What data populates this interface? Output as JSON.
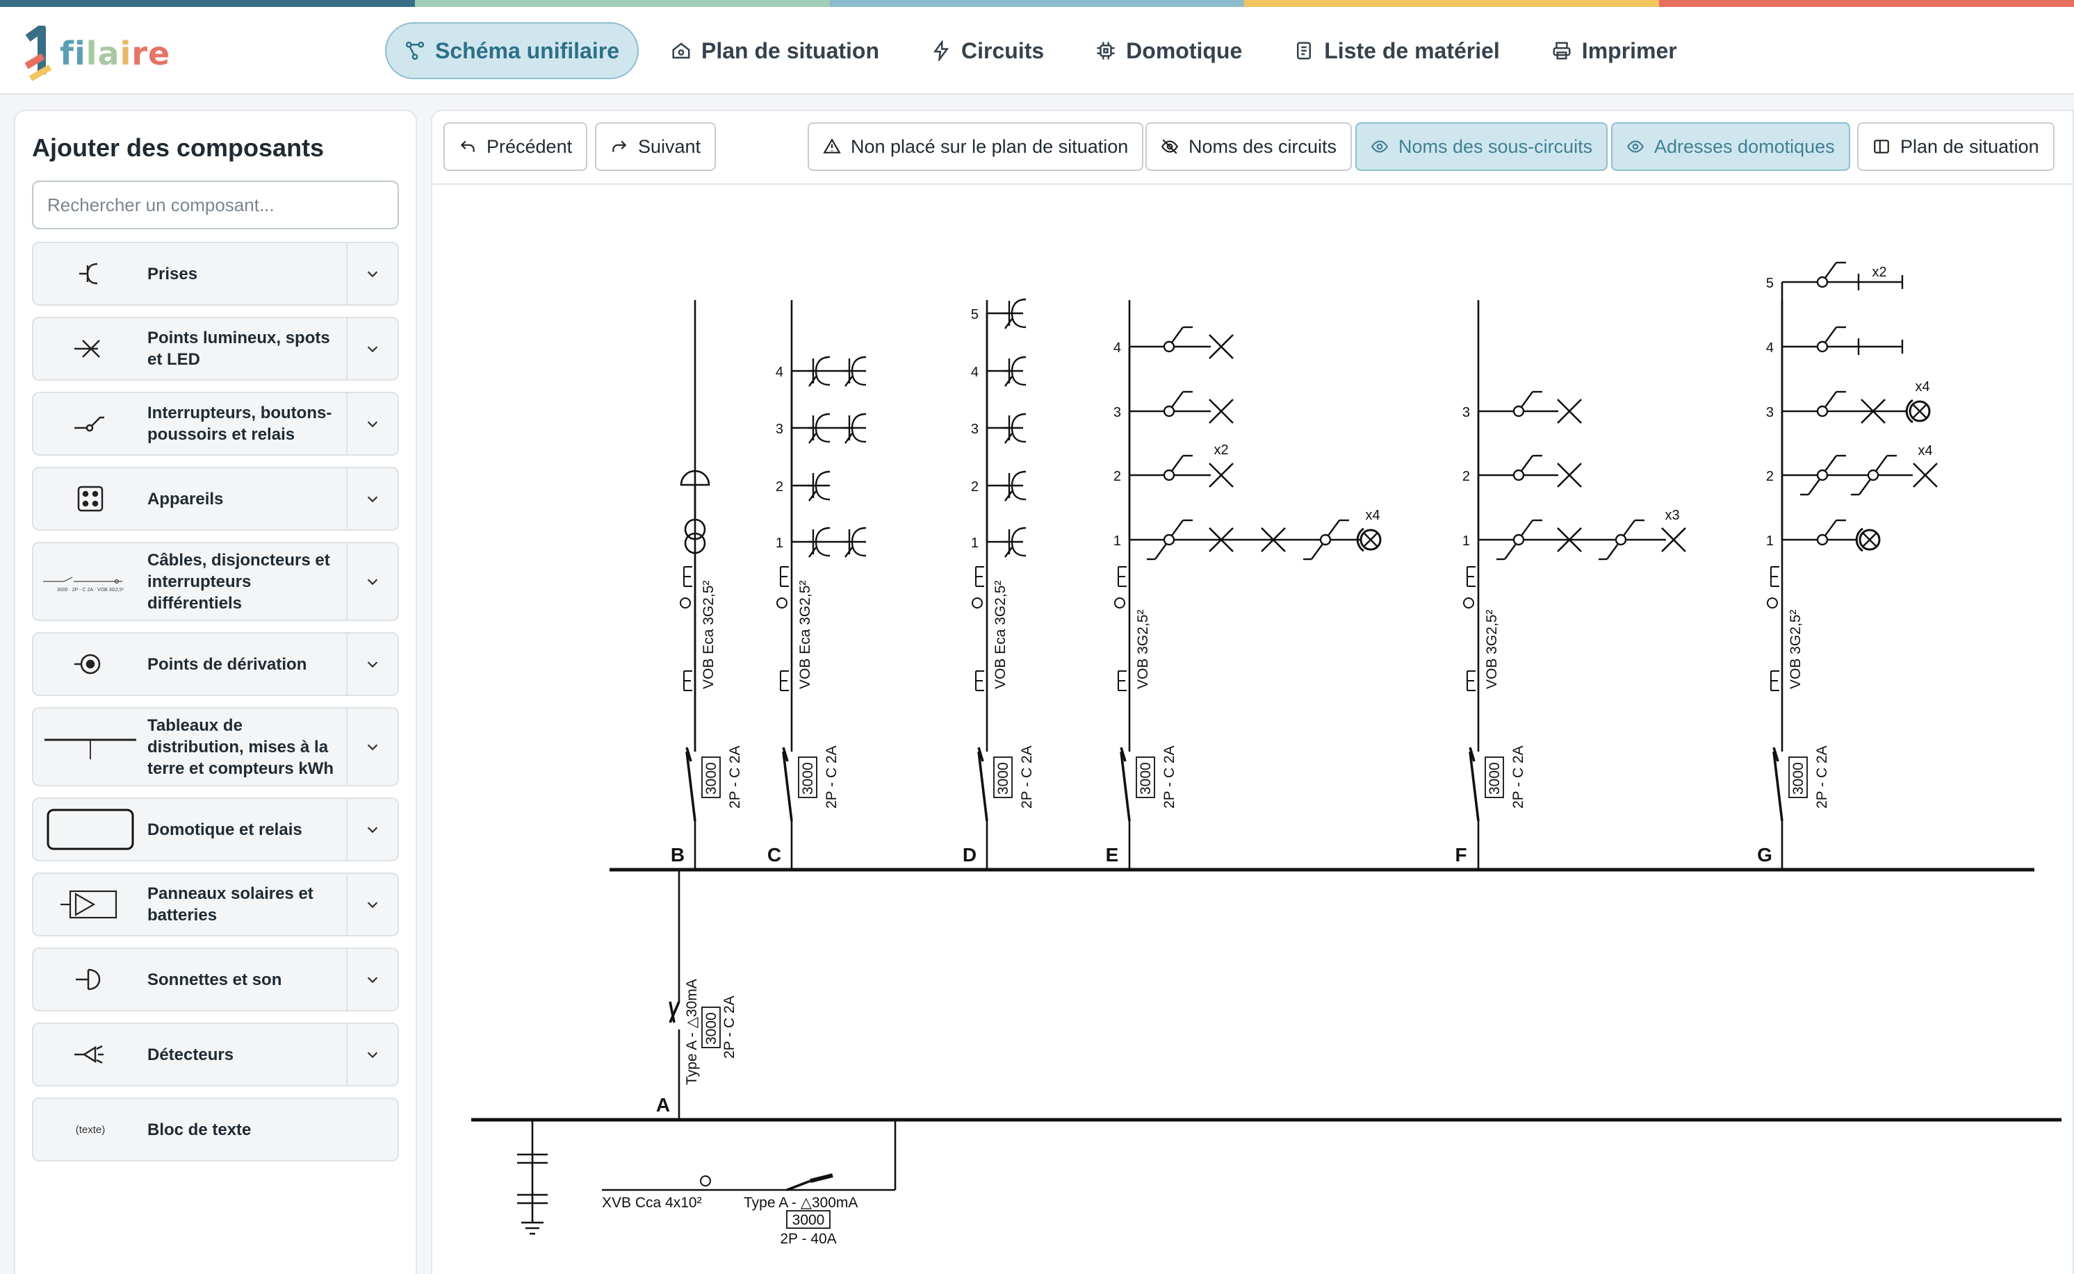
{
  "colors": {
    "bar": [
      "#3a6e86",
      "#9fcfb6",
      "#8bbbcc",
      "#f2c55f",
      "#e5705e"
    ],
    "accent": "#cfe6ee"
  },
  "app": {
    "logo_parts": [
      "fi",
      "la",
      "i",
      "re"
    ]
  },
  "nav": [
    {
      "label": "Schéma unifilaire",
      "icon": "schema-icon",
      "active": true
    },
    {
      "label": "Plan de situation",
      "icon": "house-icon"
    },
    {
      "label": "Circuits",
      "icon": "bolt-icon"
    },
    {
      "label": "Domotique",
      "icon": "chip-icon"
    },
    {
      "label": "Liste de matériel",
      "icon": "list-icon"
    },
    {
      "label": "Imprimer",
      "icon": "printer-icon"
    }
  ],
  "sidebar": {
    "title": "Ajouter des composants",
    "search_placeholder": "Rechercher un composant...",
    "categories": [
      {
        "label": "Prises",
        "icon": "socket-icon"
      },
      {
        "label": "Points lumineux, spots et LED",
        "icon": "light-point-icon"
      },
      {
        "label": "Interrupteurs, boutons-poussoirs et relais",
        "icon": "switch-icon"
      },
      {
        "label": "Appareils",
        "icon": "appliance-icon"
      },
      {
        "label": "Câbles, disjoncteurs et interrupteurs différentiels",
        "icon": "cable-breaker-icon",
        "icon_text": "3000 · 2P - C 2A · VOB 3G2,5²"
      },
      {
        "label": "Points de dérivation",
        "icon": "junction-icon"
      },
      {
        "label": "Tableaux de distribution, mises à la terre et compteurs kWh",
        "icon": "distribution-board-icon"
      },
      {
        "label": "Domotique et relais",
        "icon": "home-automation-icon"
      },
      {
        "label": "Panneaux solaires et batteries",
        "icon": "solar-panel-icon"
      },
      {
        "label": "Sonnettes et son",
        "icon": "bell-icon"
      },
      {
        "label": "Détecteurs",
        "icon": "detector-icon"
      },
      {
        "label": "Bloc de texte",
        "icon": "text-block-icon",
        "icon_text": "(texte)"
      }
    ]
  },
  "toolbar": {
    "prev": "Précédent",
    "next": "Suivant",
    "not_placed": "Non placé sur le plan de situation",
    "circuit_names": "Noms des circuits",
    "subcircuit_names": "Noms des sous-circuits",
    "domotic_addresses": "Adresses domotiques",
    "site_plan": "Plan de situation"
  },
  "schematic": {
    "circuits": [
      {
        "letter": "B",
        "cable": "VOB Eca 3G2,5²",
        "rating": "3000",
        "breaker": "2P - C 2A"
      },
      {
        "letter": "C",
        "cable": "VOB Eca 3G2,5²",
        "rating": "3000",
        "breaker": "2P - C 2A",
        "rows": [
          "4",
          "3",
          "2",
          "1"
        ]
      },
      {
        "letter": "D",
        "cable": "VOB Eca 3G2,5²",
        "rating": "3000",
        "breaker": "2P - C 2A",
        "rows": [
          "5",
          "4",
          "3",
          "2",
          "1"
        ]
      },
      {
        "letter": "E",
        "cable": "VOB 3G2,5²",
        "rating": "3000",
        "breaker": "2P - C 2A",
        "rows": [
          "4",
          "3",
          "2",
          "1"
        ],
        "mult": [
          "x2",
          "x4"
        ]
      },
      {
        "letter": "F",
        "cable": "VOB 3G2,5²",
        "rating": "3000",
        "breaker": "2P - C 2A",
        "rows": [
          "3",
          "2",
          "1"
        ],
        "mult": [
          "x3"
        ]
      },
      {
        "letter": "G",
        "cable": "VOB 3G2,5²",
        "rating": "3000",
        "breaker": "2P - C 2A",
        "rows": [
          "5",
          "4",
          "3",
          "2",
          "1"
        ],
        "mult": [
          "x2",
          "x4",
          "x4"
        ]
      }
    ],
    "circuit_a": {
      "letter": "A",
      "type": "Type A - △30mA",
      "rating": "3000",
      "breaker": "2P - C 2A"
    },
    "main": {
      "cable": "XVB Cca 4x10²",
      "type": "Type A - △300mA",
      "rating": "3000",
      "breaker": "2P - 40A"
    }
  }
}
